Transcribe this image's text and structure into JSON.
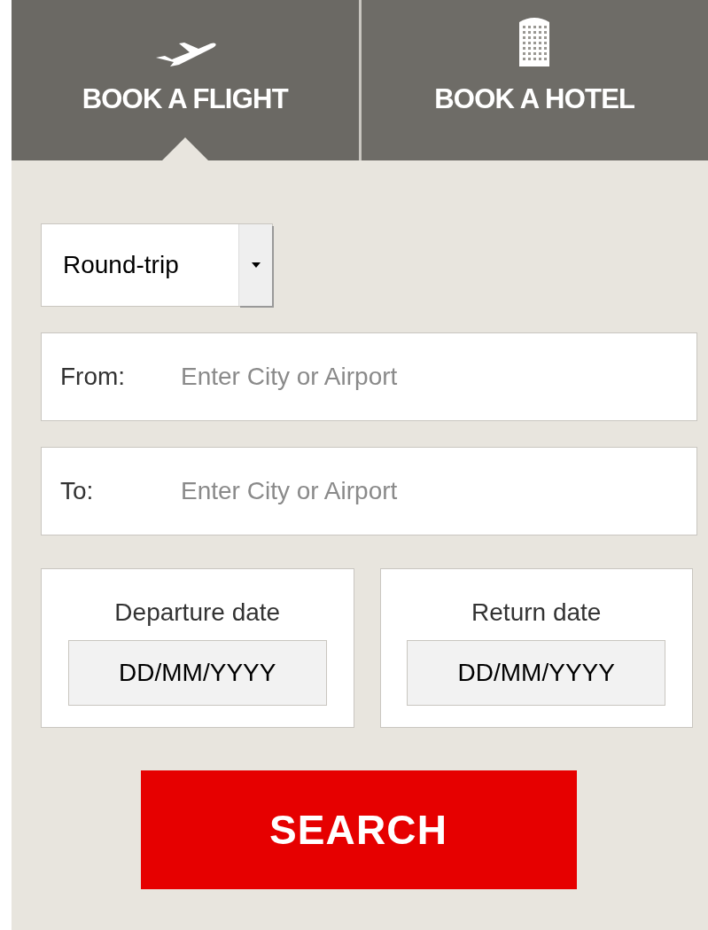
{
  "tabs": [
    {
      "label": "BOOK A FLIGHT",
      "kind": "flight",
      "selected": true
    },
    {
      "label": "BOOK A HOTEL",
      "kind": "hotel",
      "selected": false
    }
  ],
  "trip_type": {
    "value": "Round-trip"
  },
  "fields": [
    {
      "label": "From:",
      "placeholder": "Enter City or Airport"
    },
    {
      "label": "To:",
      "placeholder": "Enter City or Airport"
    }
  ],
  "dates": [
    {
      "label": "Departure date",
      "placeholder": "DD/MM/YYYY"
    },
    {
      "label": "Return date",
      "placeholder": "DD/MM/YYYY"
    }
  ],
  "search_button": "SEARCH"
}
